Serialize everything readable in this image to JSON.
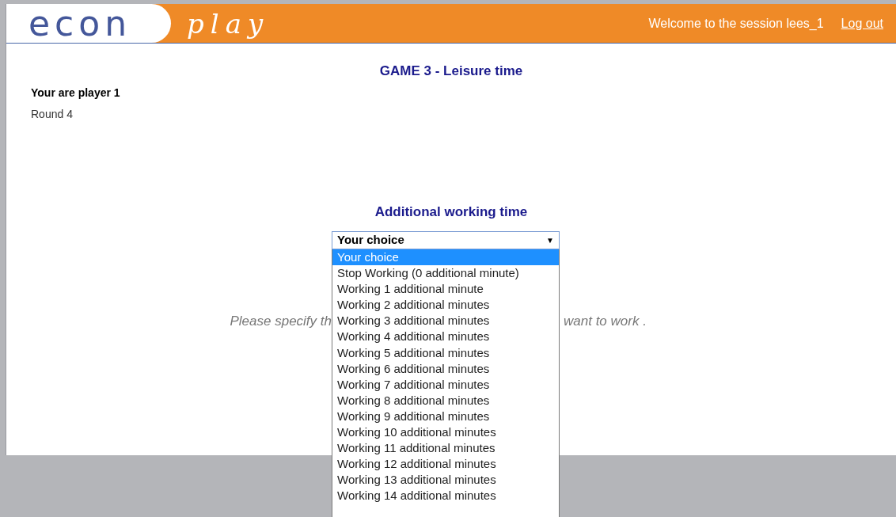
{
  "header": {
    "logo": {
      "word1": "econ",
      "word2": "play"
    },
    "welcome": "Welcome to the session lees_1",
    "logout": "Log out"
  },
  "game_title": "GAME 3 - Leisure time",
  "player": "Your are player 1",
  "round": "Round 4",
  "section_title": "Additional working time",
  "select": {
    "value": "Your choice",
    "arrow": "▼",
    "expanded": true,
    "options": [
      {
        "label": "Your choice",
        "selected": true
      },
      {
        "label": "Stop Working (0 additional minute)",
        "selected": false
      },
      {
        "label": "Working 1 additional minute",
        "selected": false
      },
      {
        "label": "Working 2 additional minutes",
        "selected": false
      },
      {
        "label": "Working 3 additional minutes",
        "selected": false
      },
      {
        "label": "Working 4 additional minutes",
        "selected": false
      },
      {
        "label": "Working 5 additional minutes",
        "selected": false
      },
      {
        "label": "Working 6 additional minutes",
        "selected": false
      },
      {
        "label": "Working 7 additional minutes",
        "selected": false
      },
      {
        "label": "Working 8 additional minutes",
        "selected": false
      },
      {
        "label": "Working 9 additional minutes",
        "selected": false
      },
      {
        "label": "Working 10 additional minutes",
        "selected": false
      },
      {
        "label": "Working 11 additional minutes",
        "selected": false
      },
      {
        "label": "Working 12 additional minutes",
        "selected": false
      },
      {
        "label": "Working 13 additional minutes",
        "selected": false
      },
      {
        "label": "Working 14 additional minutes",
        "selected": false
      }
    ]
  },
  "instruction": {
    "left_part": "Please specify th",
    "right_part": "want to work ."
  }
}
